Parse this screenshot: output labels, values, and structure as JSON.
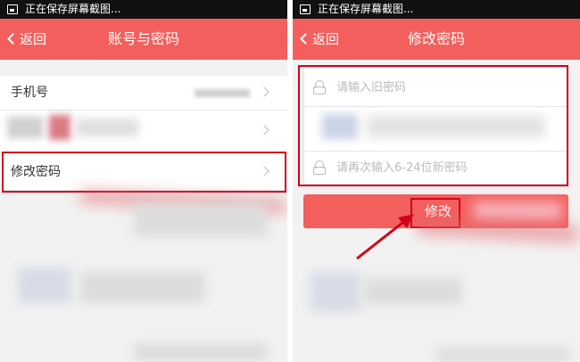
{
  "status_bar": {
    "text": "正在保存屏幕截图..."
  },
  "screens": {
    "account": {
      "back_label": "返回",
      "title": "账号与密码",
      "rows": [
        {
          "label": "手机号"
        },
        {
          "label": ""
        },
        {
          "label": "修改密码"
        }
      ]
    },
    "change_password": {
      "back_label": "返回",
      "title": "修改密码",
      "fields": {
        "old_password_placeholder": "请输入旧密码",
        "new_password_placeholder": "",
        "confirm_password_placeholder": "请再次输入6-24位新密码"
      },
      "submit_label": "修改"
    }
  },
  "colors": {
    "nav_bar": "#f35f5c",
    "annotation": "#d0021b"
  },
  "icons": [
    "screenshot-icon",
    "back-chevron-icon",
    "chevron-right-icon",
    "lock-icon"
  ]
}
